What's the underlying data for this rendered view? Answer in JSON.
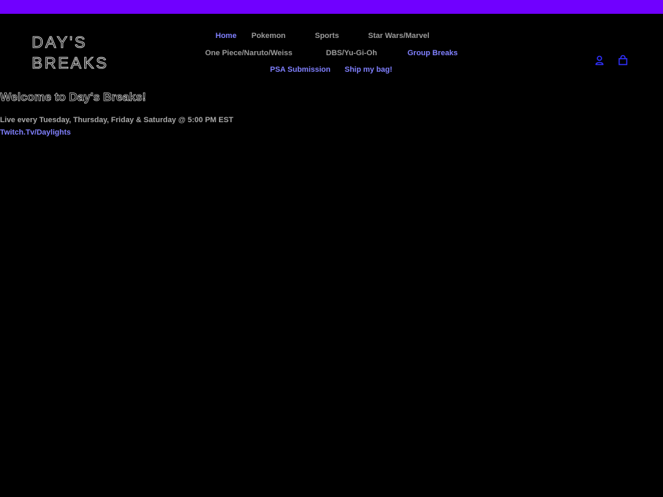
{
  "colors": {
    "top_bar": "#7000ff",
    "background": "#000000",
    "accent_link": "#8080ff",
    "icon": "#3030ff"
  },
  "header": {
    "logo": {
      "line1": "DAY'S",
      "line2": "BREAKS"
    },
    "nav": {
      "home": "Home",
      "pokemon": "Pokemon",
      "sports": "Sports",
      "starwars_marvel": "Star Wars/Marvel",
      "onepiece": "One Piece/Naruto/Weiss",
      "dbs_yugioh": "DBS/Yu-Gi-Oh",
      "group_breaks": "Group Breaks",
      "psa": "PSA Submission",
      "ship": "Ship my bag!"
    },
    "icons": {
      "account": "account-icon",
      "cart": "cart-icon"
    }
  },
  "main": {
    "welcome": "Welcome to Day's Breaks!",
    "schedule": "Live every Tuesday, Thursday, Friday & Saturday @ 5:00 PM EST",
    "twitch": "Twitch.Tv/Daylights"
  }
}
